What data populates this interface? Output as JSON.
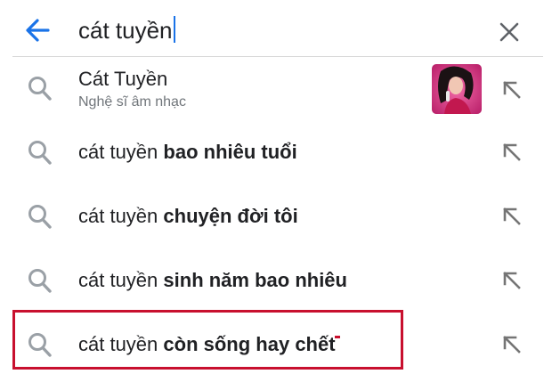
{
  "search": {
    "query": "cát tuyền"
  },
  "icons": {
    "back": "arrow-left-icon",
    "clear": "close-icon",
    "search": "search-icon",
    "fill": "arrow-up-left-icon"
  },
  "colors": {
    "accent": "#1a73e8",
    "highlight": "#c8102e",
    "subtitle": "#70757a"
  },
  "entity": {
    "title": "Cát Tuyền",
    "subtitle": "Nghệ sĩ âm nhạc"
  },
  "suggestions": [
    {
      "prefix": "cát tuyền",
      "bold": "bao nhiêu tuổi"
    },
    {
      "prefix": "cát tuyền",
      "bold": "chuyện đời tôi"
    },
    {
      "prefix": "cát tuyền",
      "bold": "sinh năm bao nhiêu"
    },
    {
      "prefix": "cát tuyền",
      "bold": "còn sống hay chết"
    }
  ]
}
